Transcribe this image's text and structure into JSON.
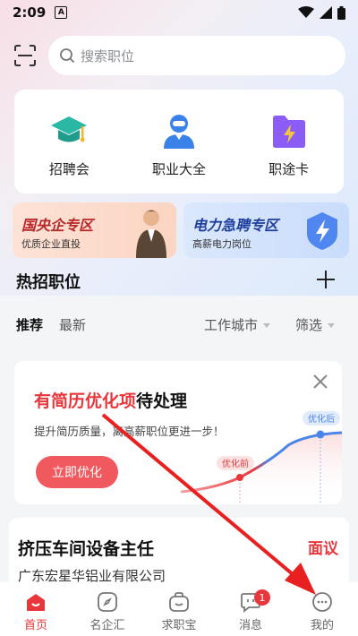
{
  "status_bar": {
    "time": "2:09",
    "notification_letter": "A"
  },
  "search": {
    "placeholder": "搜索职位"
  },
  "quick_entries": [
    {
      "label": "招聘会",
      "icon": "graduation-cap-icon"
    },
    {
      "label": "职业大全",
      "icon": "person-icon"
    },
    {
      "label": "职途卡",
      "icon": "lightning-folder-icon"
    }
  ],
  "promos": [
    {
      "title": "国央企专区",
      "subtitle": "优质企业直投"
    },
    {
      "title": "电力急聘专区",
      "subtitle": "高薪电力岗位"
    }
  ],
  "hot_jobs": {
    "title": "热招职位",
    "tabs": {
      "recommend": "推荐",
      "newest": "最新"
    },
    "filters": {
      "city": "工作城市",
      "filter": "筛选"
    }
  },
  "resume_card": {
    "title_highlight": "有简历优化项",
    "title_rest": "待处理",
    "description": "提升简历质量，离高薪职位更进一步！",
    "button": "立即优化",
    "before_label": "优化前",
    "after_label": "优化后"
  },
  "job": {
    "title": "挤压车间设备主任",
    "salary": "面议",
    "company": "广东宏星华铝业有限公司"
  },
  "tabbar": {
    "items": [
      {
        "label": "首页",
        "icon": "home-icon"
      },
      {
        "label": "名企汇",
        "icon": "compass-icon"
      },
      {
        "label": "求职宝",
        "icon": "bag-icon"
      },
      {
        "label": "消息",
        "icon": "message-icon",
        "badge": "1"
      },
      {
        "label": "我的",
        "icon": "profile-icon"
      }
    ]
  },
  "colors": {
    "accent": "#e8373c",
    "button": "#f05a5f",
    "curve": "#4a86e8"
  }
}
